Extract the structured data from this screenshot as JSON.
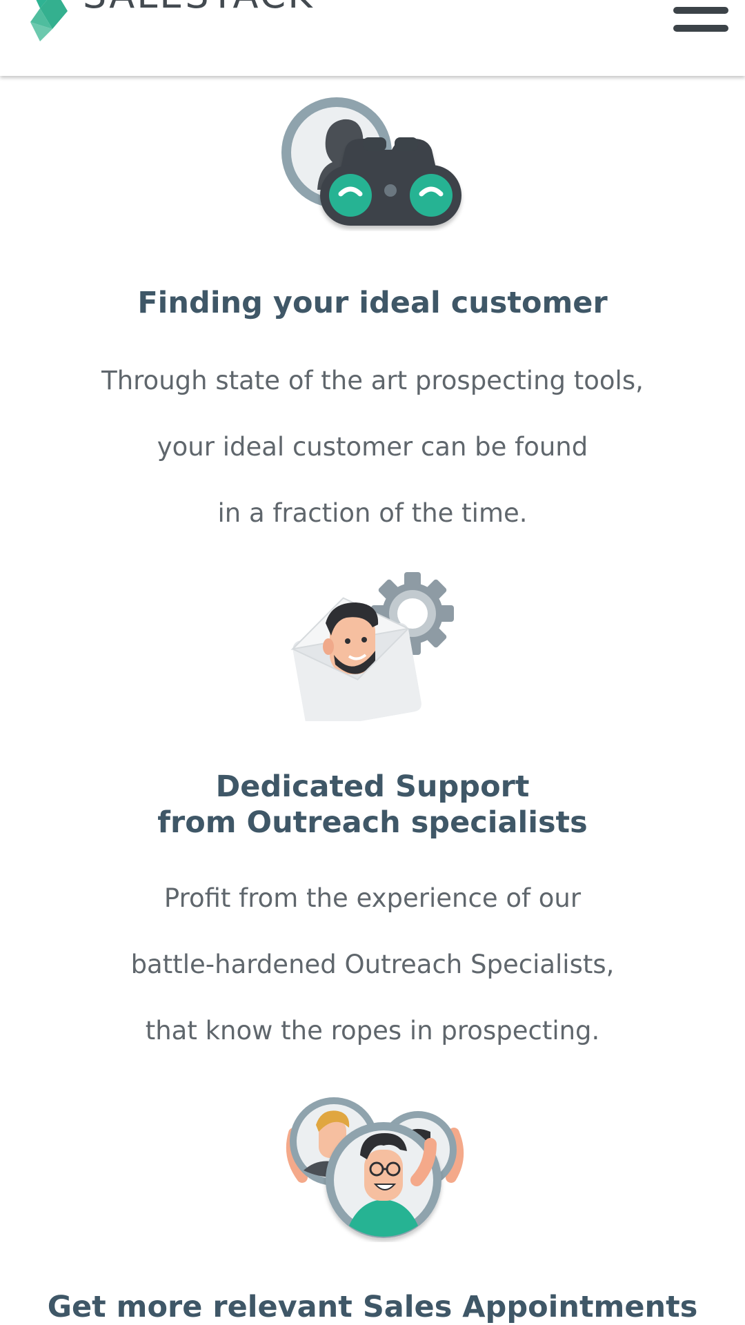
{
  "header": {
    "brand": "SALESTACK",
    "brand_colors": {
      "mark_dark": "#2fb393",
      "mark_light": "#5fc4a8",
      "text": "#434a50"
    },
    "menu_icon": "hamburger-icon"
  },
  "features": [
    {
      "icon": "binoculars-prospect-icon",
      "title": "Finding your ideal customer",
      "body_lines": [
        "Through state of the art prospecting tools,",
        "your ideal customer can be found",
        "in a fraction of the time."
      ]
    },
    {
      "icon": "envelope-gear-specialist-icon",
      "title_lines": [
        "Dedicated Support",
        "from Outreach specialists"
      ],
      "body_lines": [
        "Profit from the experience of our",
        "battle-hardened Outreach Specialists,",
        "that know the ropes in prospecting."
      ]
    },
    {
      "icon": "cheering-team-icon",
      "title": "Get more relevant Sales Appointments"
    }
  ],
  "colors": {
    "title": "#3f5767",
    "body": "#5f666c",
    "accent": "#26b393"
  }
}
